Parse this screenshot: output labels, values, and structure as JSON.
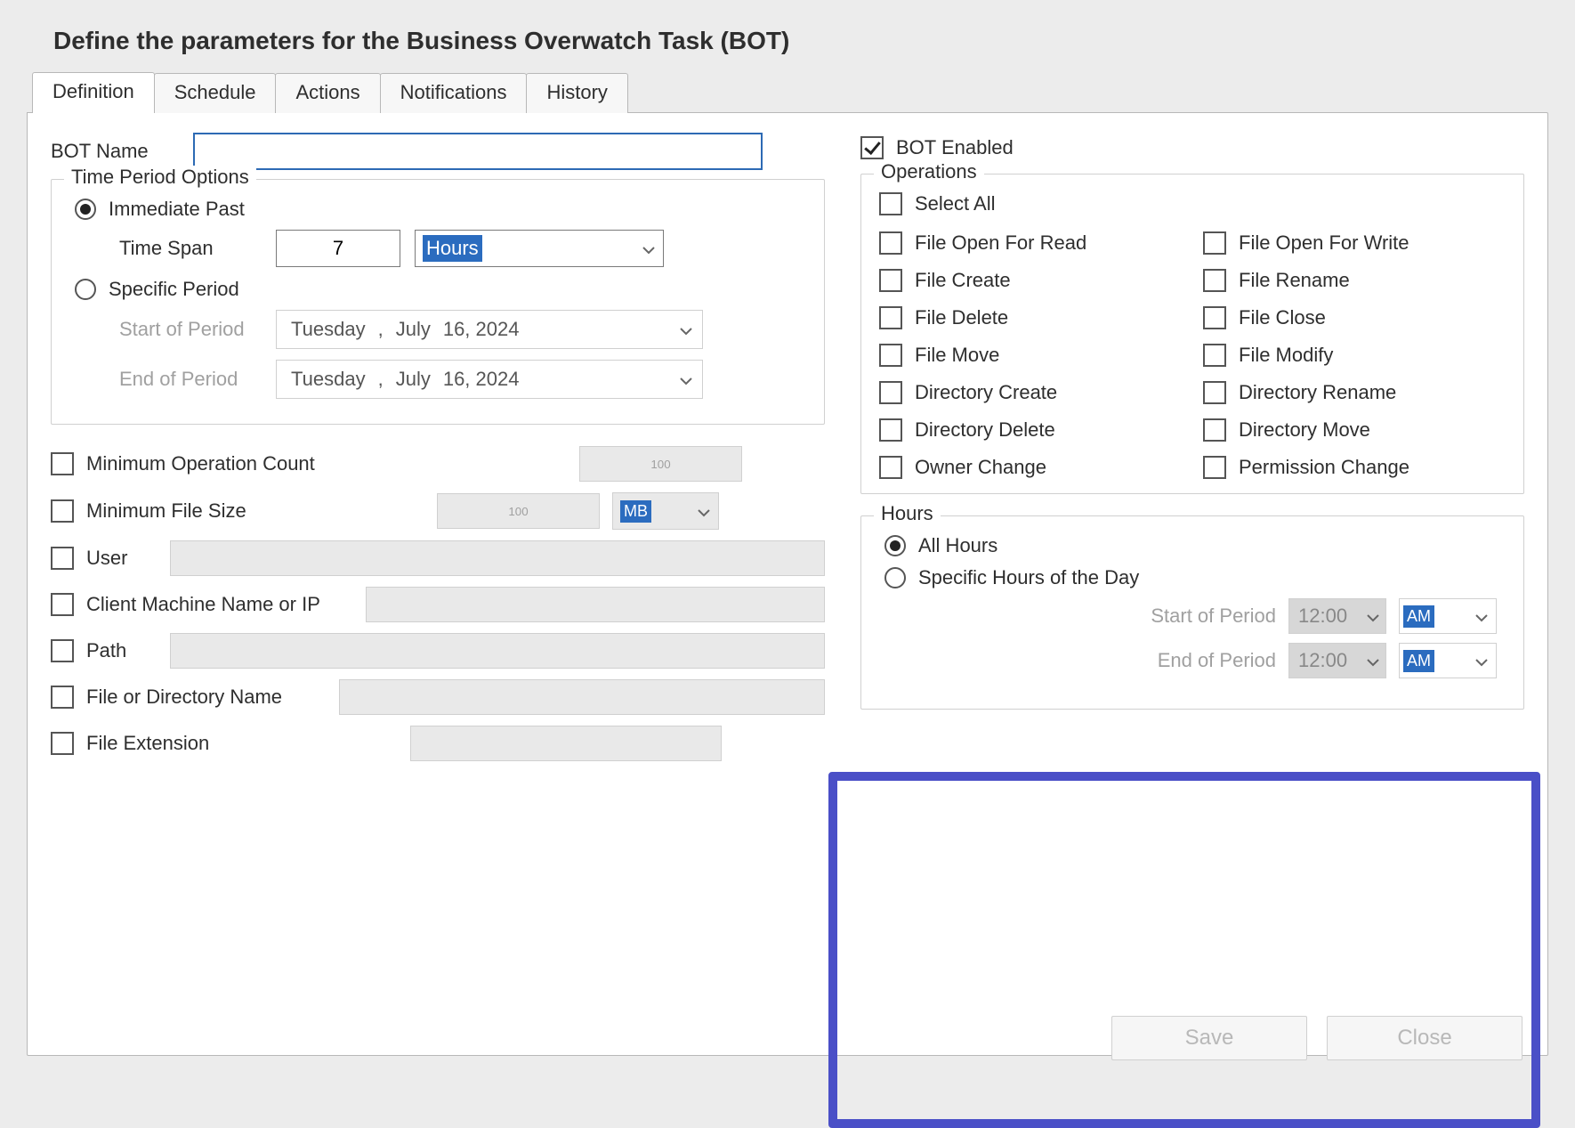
{
  "title": "Define the parameters for the Business Overwatch Task (BOT)",
  "tabs": [
    "Definition",
    "Schedule",
    "Actions",
    "Notifications",
    "History"
  ],
  "active_tab_index": 0,
  "bot_name": {
    "label": "BOT Name",
    "value": ""
  },
  "bot_enabled": {
    "label": "BOT Enabled",
    "checked": true
  },
  "time_period": {
    "legend": "Time Period Options",
    "immediate_past": {
      "label": "Immediate Past",
      "selected": true,
      "time_span_label": "Time Span",
      "time_span_value": "7",
      "time_span_unit": "Hours"
    },
    "specific_period": {
      "label": "Specific Period",
      "selected": false,
      "start_label": "Start of Period",
      "end_label": "End of Period",
      "start_value": {
        "dow": "Tuesday",
        "sep": ",",
        "month": "July",
        "dy": "16, 2024"
      },
      "end_value": {
        "dow": "Tuesday",
        "sep": ",",
        "month": "July",
        "dy": "16, 2024"
      }
    }
  },
  "filters": {
    "min_op_count": {
      "label": "Minimum Operation Count",
      "value": "100",
      "checked": false
    },
    "min_file_size": {
      "label": "Minimum File Size",
      "value": "100",
      "unit": "MB",
      "checked": false
    },
    "user": {
      "label": "User",
      "checked": false
    },
    "client": {
      "label": "Client Machine Name or IP",
      "checked": false
    },
    "path": {
      "label": "Path",
      "checked": false
    },
    "name": {
      "label": "File or Directory Name",
      "checked": false
    },
    "ext": {
      "label": "File Extension",
      "checked": false
    }
  },
  "operations": {
    "legend": "Operations",
    "select_all": "Select All",
    "items_left": [
      "File Open For Read",
      "File Create",
      "File Delete",
      "File Move",
      "Directory Create",
      "Directory Delete",
      "Owner Change"
    ],
    "items_right": [
      "File Open For Write",
      "File Rename",
      "File Close",
      "File Modify",
      "Directory Rename",
      "Directory Move",
      "Permission Change"
    ]
  },
  "hours": {
    "legend": "Hours",
    "all_hours": {
      "label": "All Hours",
      "selected": true
    },
    "specific": {
      "label": "Specific Hours of the Day",
      "selected": false,
      "start_label": "Start of Period",
      "end_label": "End of Period",
      "start_time": "12:00",
      "end_time": "12:00",
      "start_ampm": "AM",
      "end_ampm": "AM"
    }
  },
  "buttons": {
    "save": "Save",
    "close": "Close"
  }
}
